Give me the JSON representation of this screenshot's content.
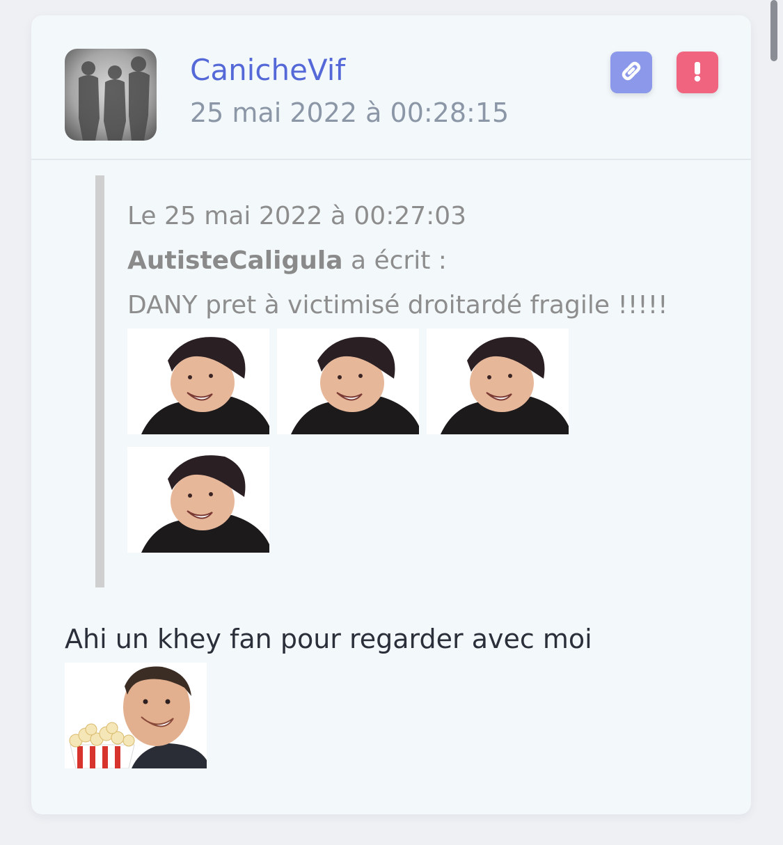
{
  "post": {
    "username": "CanicheVif",
    "date": "25 mai 2022 à 00:28:15",
    "avatar_icon": "avatar-silhouettes-image",
    "actions": {
      "link_icon": "link-icon",
      "report_icon": "exclamation-icon",
      "link_color": "#8c99ea",
      "report_color": "#f0647f"
    }
  },
  "quote": {
    "meta": "Le 25 mai 2022 à 00:27:03",
    "author": "AutisteCaligula",
    "author_suffix": " a écrit :",
    "text": "DANY pret à victimisé droitardé fragile !!!!!",
    "stickers": [
      "smiling-man-sticker",
      "smiling-man-sticker",
      "smiling-man-sticker",
      "smiling-man-sticker"
    ]
  },
  "reply": {
    "text": "Ahi un khey fan pour regarder avec moi",
    "sticker": "popcorn-man-sticker"
  },
  "colors": {
    "username": "#5568d8",
    "date": "#8b96a6",
    "quote_bar": "#cfcfcf",
    "card_bg": "#f3f8fb"
  }
}
